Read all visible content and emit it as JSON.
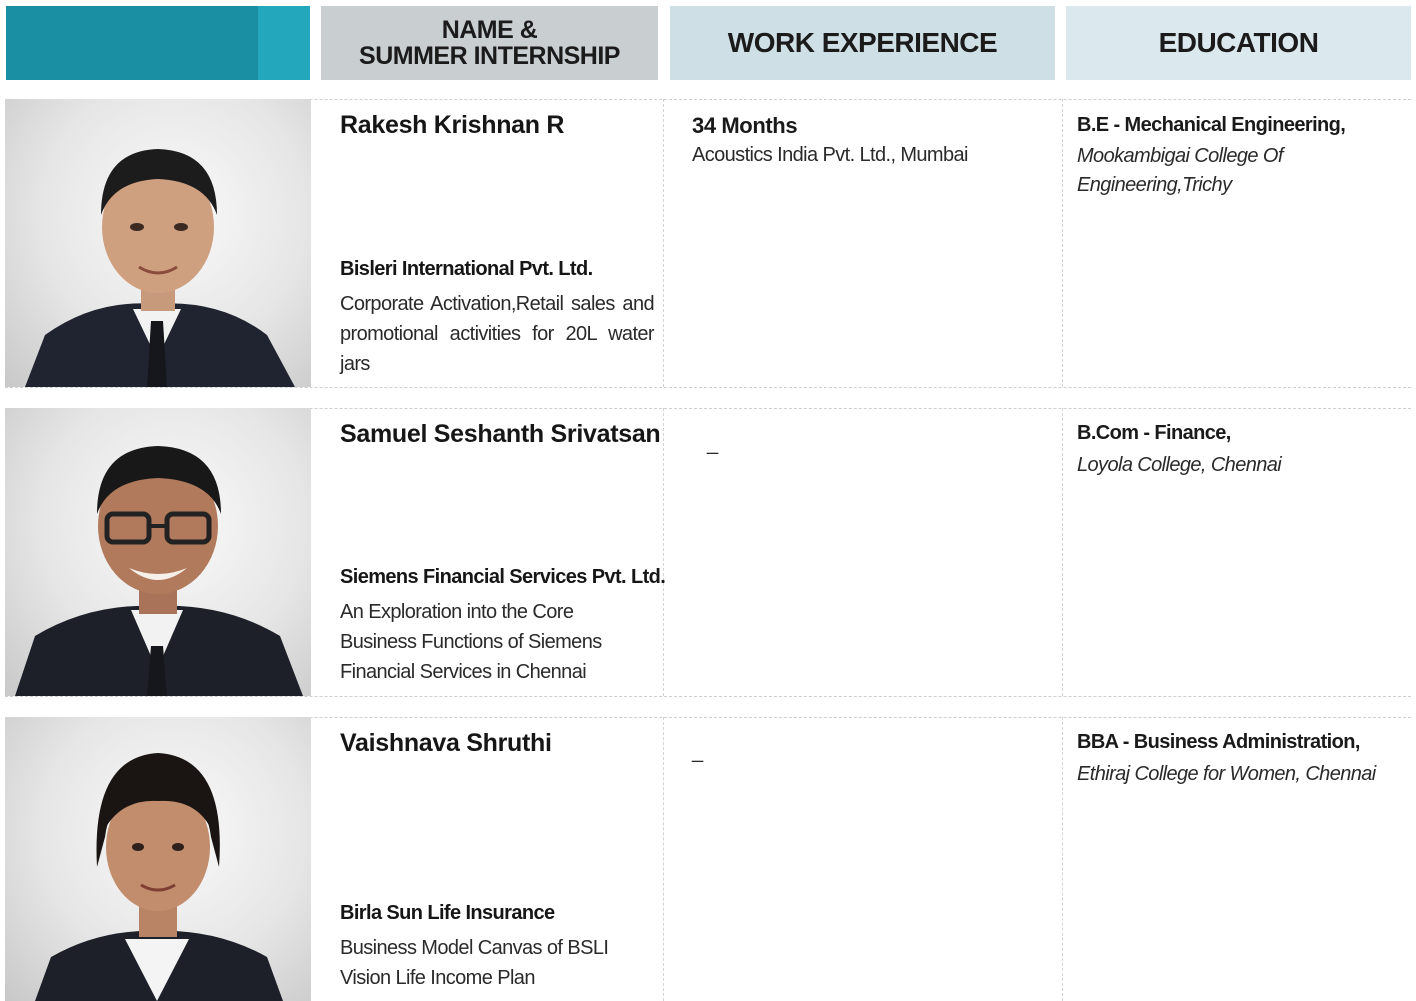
{
  "header": {
    "name_col": "NAME &\nSUMMER INTERNSHIP",
    "work_col": "WORK EXPERIENCE",
    "edu_col": "EDUCATION"
  },
  "students": [
    {
      "name": "Rakesh Krishnan R",
      "internship_company": "Bisleri International Pvt. Ltd.",
      "internship_description": "Corporate Activation,Retail sales and promotional activities for 20L water jars",
      "work_duration": "34 Months",
      "work_company": "Acoustics India Pvt. Ltd., Mumbai",
      "education_degree": "B.E - Mechanical Engineering,",
      "education_institution": "Mookambigai College Of Engineering,Trichy"
    },
    {
      "name": "Samuel Seshanth Srivatsan",
      "internship_company": "Siemens Financial Services Pvt. Ltd.",
      "internship_description": "An Exploration into the Core Business Functions of Siemens Financial Services in Chennai",
      "work_placeholder": "_",
      "education_degree": "B.Com - Finance,",
      "education_institution": "Loyola College, Chennai"
    },
    {
      "name": "Vaishnava Shruthi",
      "internship_company": "Birla Sun Life Insurance",
      "internship_description": "Business Model Canvas of BSLI Vision Life Income Plan",
      "work_placeholder": "_",
      "education_degree": "BBA - Business Administration,",
      "education_institution": "Ethiraj College for Women, Chennai"
    }
  ],
  "colors": {
    "header_accent": "#1a8ea3",
    "header_name_bg": "#c9ced1",
    "header_work_bg": "#cfdfe6",
    "header_edu_bg": "#dbe8ee"
  }
}
